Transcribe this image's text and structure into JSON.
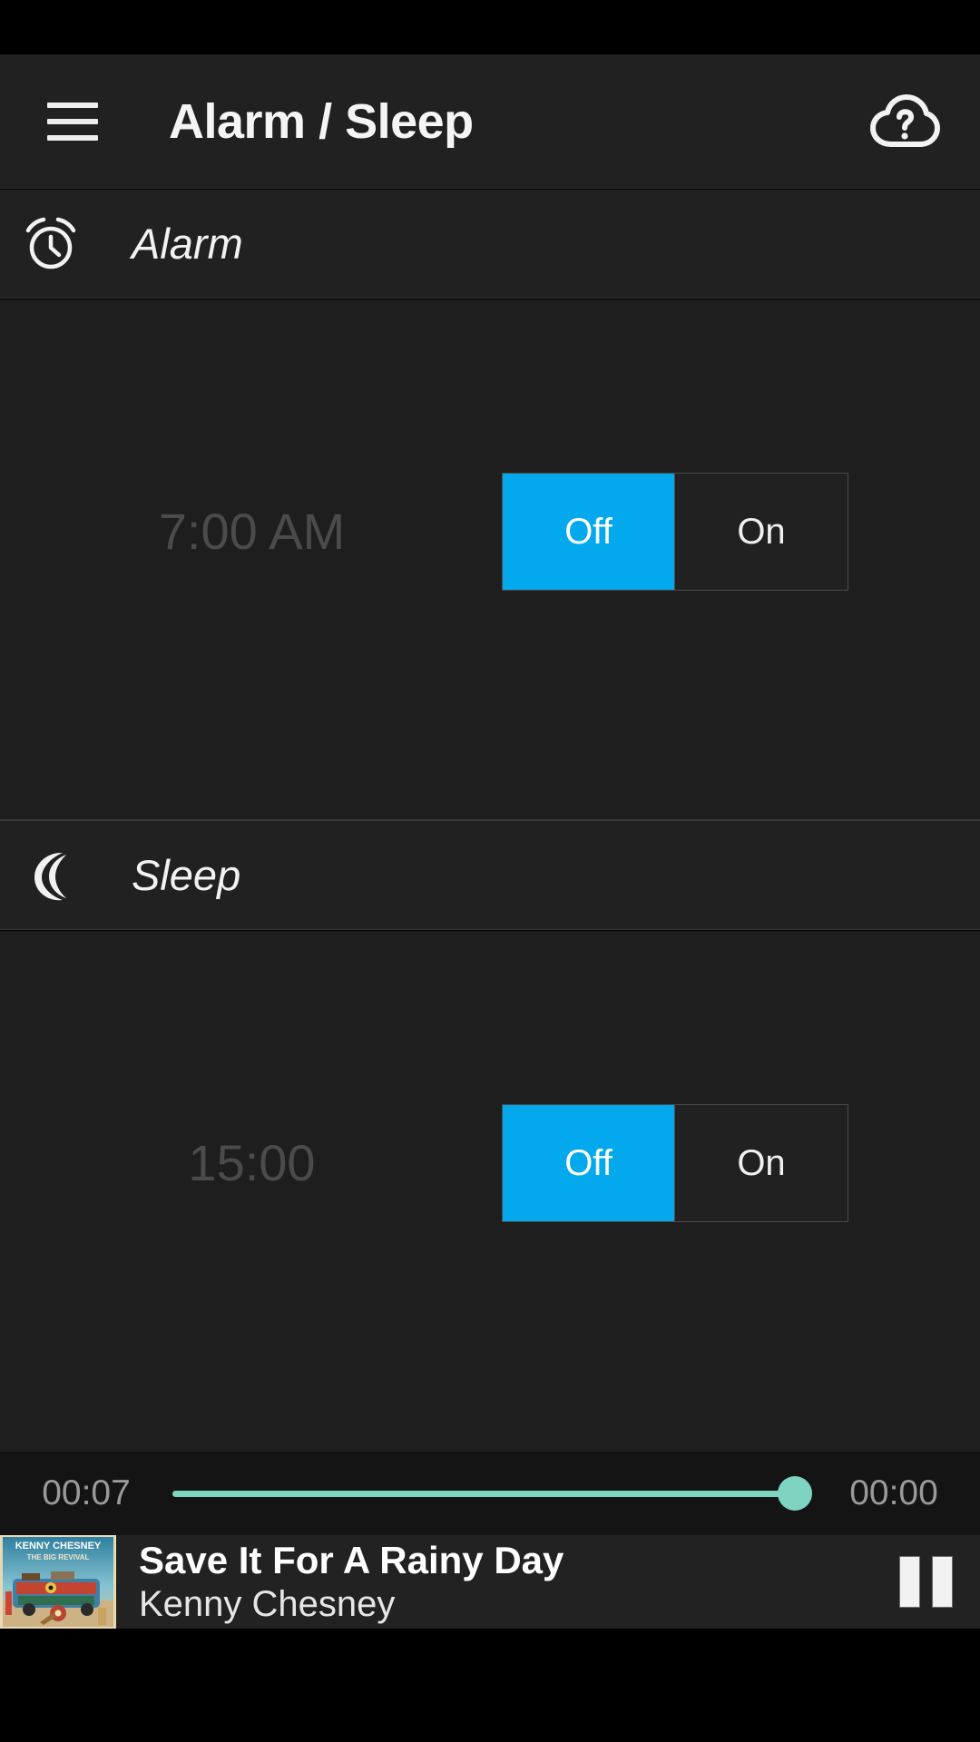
{
  "app": {
    "title": "Alarm / Sleep",
    "menu_icon": "hamburger-menu-icon",
    "help_icon": "cloud-question-icon"
  },
  "theme": {
    "accent": "#03a9ec",
    "background": "#1e1e1e",
    "surface": "#212121",
    "seek_accent": "#7fd4c1",
    "dim_text": "#4b4b4b"
  },
  "sections": [
    {
      "id": "alarm",
      "label": "Alarm",
      "icon": "alarm-clock-icon",
      "time_value": "7:00 AM",
      "toggle": {
        "off_label": "Off",
        "on_label": "On",
        "selected": "Off"
      }
    },
    {
      "id": "sleep",
      "label": "Sleep",
      "icon": "crescent-moon-icon",
      "time_value": "15:00",
      "toggle": {
        "off_label": "Off",
        "on_label": "On",
        "selected": "Off"
      }
    }
  ],
  "player": {
    "elapsed": "00:07",
    "remaining": "00:00",
    "progress_percent": 98,
    "track_title": "Save It For A Rainy Day",
    "artist": "Kenny Chesney",
    "album_art": {
      "artist_line": "KENNY CHESNEY",
      "album_line": "THE BIG REVIVAL"
    },
    "transport_icon": "pause-icon"
  }
}
